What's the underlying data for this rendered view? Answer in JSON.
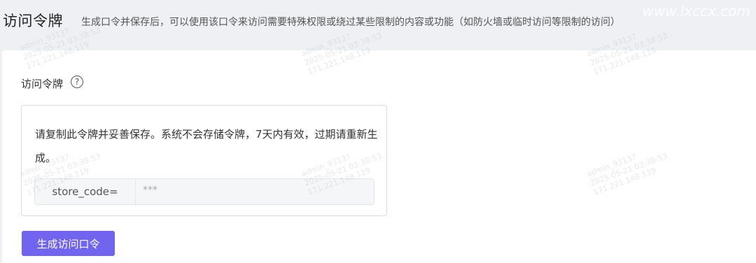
{
  "header": {
    "title": "访问令牌",
    "description": "生成口令并保存后，可以使用该口令来访问需要特殊权限或绕过某些限制的内容或功能（如防火墙或临时访问等限制的访问）",
    "site_watermark": "www.lxccx.com"
  },
  "field": {
    "label": "访问令牌",
    "help_icon": "?"
  },
  "token_box": {
    "notice": "请复制此令牌并妥善保存。系统不会存储令牌，7天内有效，过期请重新生成。",
    "prefix": "store_code=",
    "value": "***"
  },
  "actions": {
    "generate_label": "生成访问口令"
  },
  "watermark": {
    "user": "admin_93137",
    "time": "2025-05-21 03:38:53",
    "ip": "171.221.148.119"
  }
}
